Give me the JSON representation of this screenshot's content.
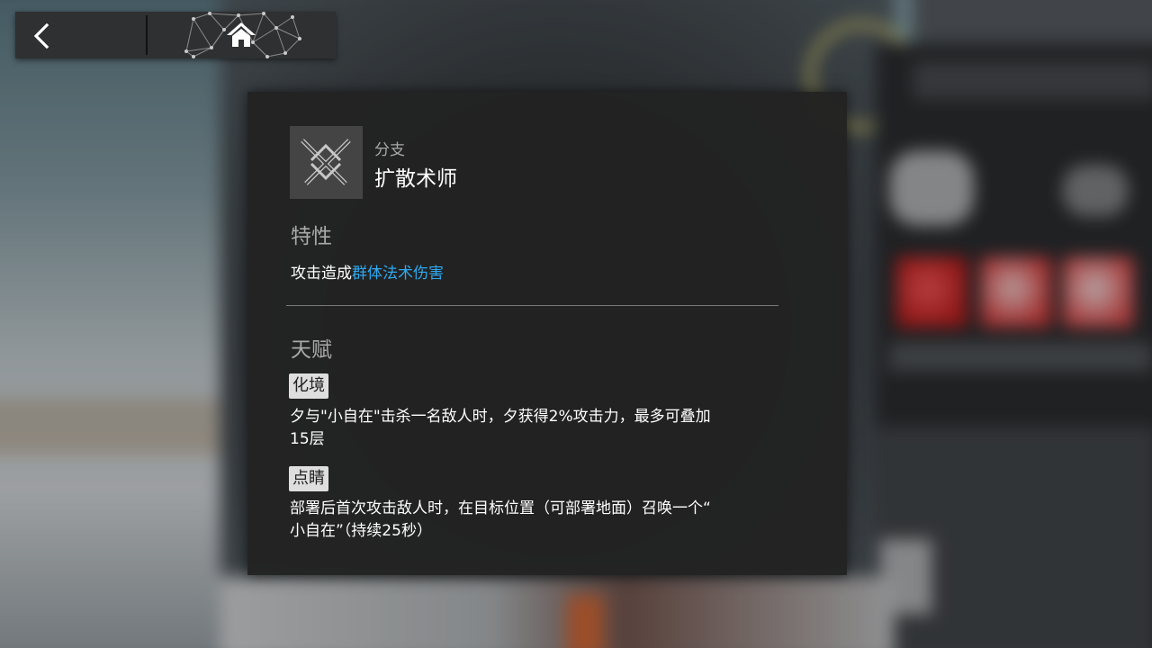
{
  "nav": {
    "back_icon": "chevron-left-icon",
    "home_icon": "home-icon"
  },
  "panel": {
    "branch_icon": "crossed-blades-icon",
    "branch_caption": "分支",
    "branch_name": "扩散术师",
    "trait": {
      "title": "特性",
      "text_prefix": "攻击造成",
      "text_highlight": "群体法术伤害",
      "highlight_color": "#2ea9f1"
    },
    "talent": {
      "title": "天赋",
      "items": [
        {
          "name": "化境",
          "desc_line1": "夕与\"小自在\"击杀一名敌人时，夕获得2%攻击力，最多可叠加",
          "desc_line2": "15层"
        },
        {
          "name": "点睛",
          "desc_line1": "部署后首次攻击敌人时，在目标位置（可部署地面）召唤一个“",
          "desc_line2": "小自在”（持续25秒）"
        }
      ]
    }
  }
}
